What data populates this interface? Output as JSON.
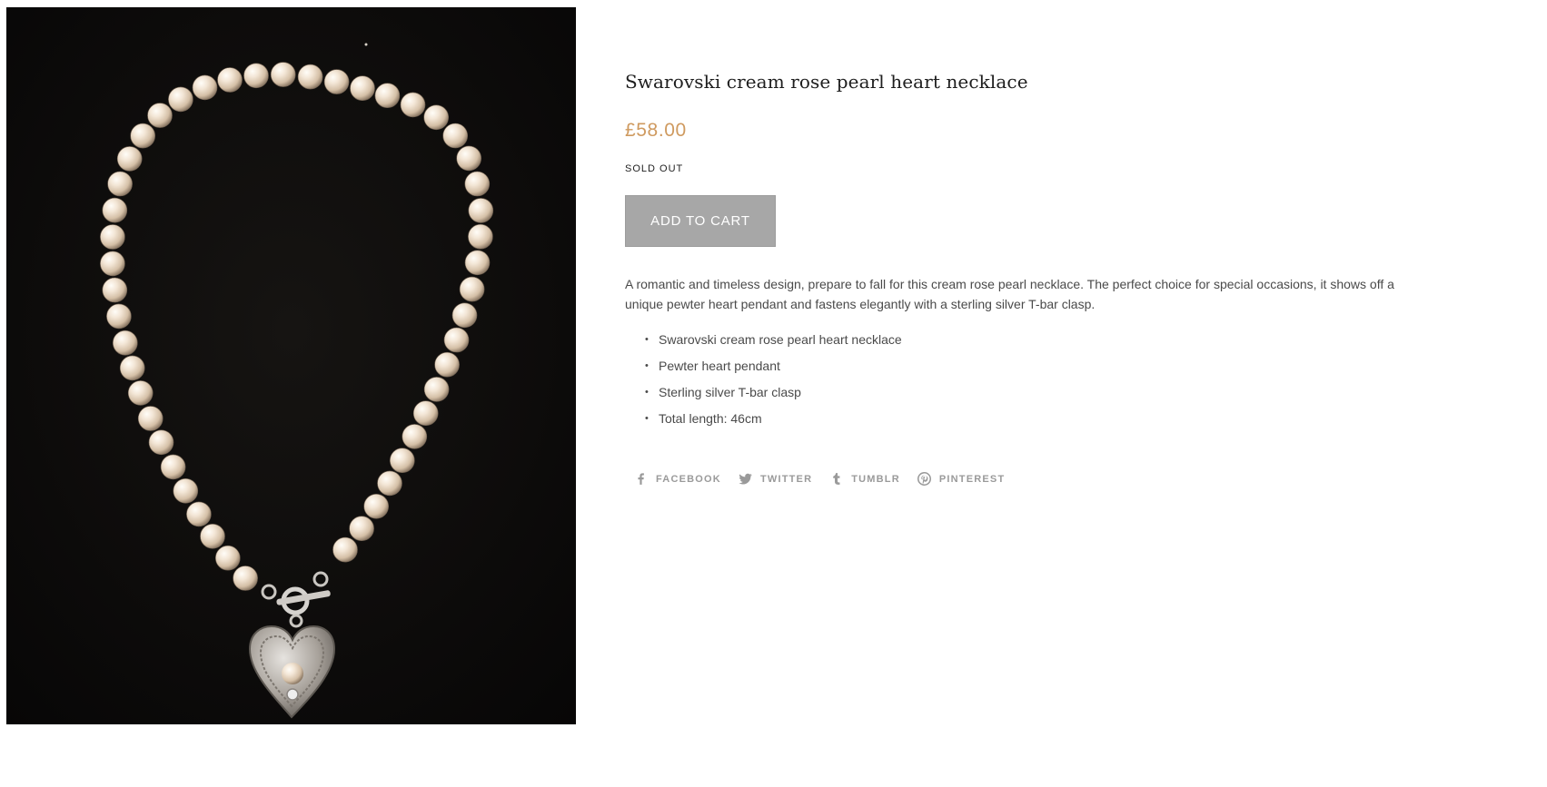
{
  "product": {
    "image_alt": "Cream rose pearl necklace with pewter heart pendant on black background",
    "title": "Swarovski cream rose pearl heart necklace",
    "price": "£58.00",
    "stock_status": "SOLD OUT",
    "add_to_cart_label": "ADD TO CART",
    "description": "A romantic and timeless design, prepare to fall for this cream rose pearl necklace. The perfect choice for special occasions, it shows off a unique pewter heart pendant and fastens elegantly with a sterling silver T-bar clasp.",
    "features": [
      "Swarovski cream rose pearl heart necklace",
      "Pewter heart pendant",
      "Sterling silver T-bar clasp",
      "Total length: 46cm"
    ]
  },
  "share": {
    "facebook": {
      "label": "FACEBOOK",
      "icon": "facebook-icon"
    },
    "twitter": {
      "label": "TWITTER",
      "icon": "twitter-icon"
    },
    "tumblr": {
      "label": "TUMBLR",
      "icon": "tumblr-icon"
    },
    "pinterest": {
      "label": "PINTEREST",
      "icon": "pinterest-icon"
    }
  },
  "colors": {
    "price": "#cf9a5f",
    "button_bg": "#a7a7a7",
    "share_text": "#9a9a9a",
    "image_bg": "#0d0c0b"
  }
}
